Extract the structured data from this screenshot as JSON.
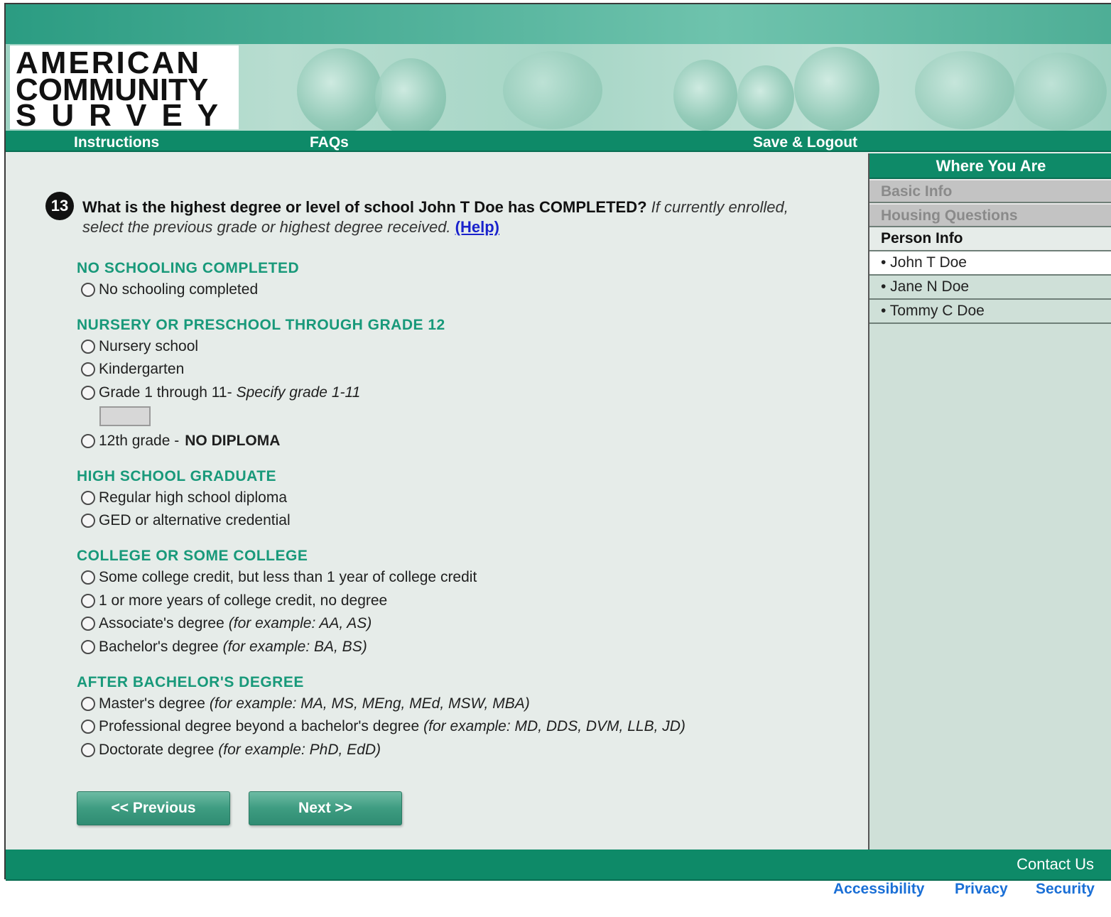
{
  "header": {
    "logo_line1": "AMERICAN",
    "logo_line2": "COMMUNITY",
    "logo_line3": "SURVEY"
  },
  "nav": {
    "instructions": "Instructions",
    "faqs": "FAQs",
    "save_logout": "Save & Logout"
  },
  "question": {
    "number": "13",
    "text": "What is the highest degree or level of school John T Doe has COMPLETED?",
    "instruction": "If currently enrolled, select the previous grade or highest degree received.",
    "help": "(Help)"
  },
  "sections": {
    "none": {
      "heading": "NO SCHOOLING COMPLETED",
      "options": [
        "No schooling completed"
      ]
    },
    "nursery": {
      "heading": "NURSERY OR PRESCHOOL THROUGH GRADE 12",
      "opt_nursery": "Nursery school",
      "opt_kindergarten": "Kindergarten",
      "opt_grade": "Grade 1 through 11-",
      "opt_grade_specify": "Specify grade 1-11",
      "opt_12th": "12th grade -",
      "opt_12th_bold": "NO DIPLOMA",
      "grade_input_value": ""
    },
    "highschool": {
      "heading": "HIGH SCHOOL GRADUATE",
      "opt_regular": "Regular high school diploma",
      "opt_ged": "GED or alternative credential"
    },
    "college": {
      "heading": "COLLEGE OR SOME COLLEGE",
      "opt_some": "Some college credit, but less than 1 year of college credit",
      "opt_more": "1 or more years of college credit, no degree",
      "opt_assoc": "Associate's degree",
      "opt_assoc_ex": "(for example: AA, AS)",
      "opt_bach": "Bachelor's degree",
      "opt_bach_ex": "(for example: BA, BS)"
    },
    "after": {
      "heading": "AFTER BACHELOR'S DEGREE",
      "opt_master": "Master's degree",
      "opt_master_ex": "(for example: MA, MS, MEng, MEd, MSW, MBA)",
      "opt_prof": "Professional degree beyond a bachelor's degree",
      "opt_prof_ex": "(for example: MD, DDS, DVM, LLB, JD)",
      "opt_doc": "Doctorate degree",
      "opt_doc_ex": "(for example: PhD, EdD)"
    }
  },
  "buttons": {
    "previous": "<<   Previous",
    "next": "Next   >>"
  },
  "sidebar": {
    "title": "Where You Are",
    "basic_info": "Basic Info",
    "housing": "Housing Questions",
    "person_info": "Person Info",
    "persons": [
      "• John T Doe",
      "• Jane N Doe",
      "• Tommy C Doe"
    ]
  },
  "footer": {
    "contact": "Contact Us",
    "accessibility": "Accessibility",
    "privacy": "Privacy",
    "security": "Security"
  },
  "colors": {
    "brand_green": "#0e8a68",
    "section_heading": "#18997a",
    "link_blue": "#1a6fd6"
  }
}
